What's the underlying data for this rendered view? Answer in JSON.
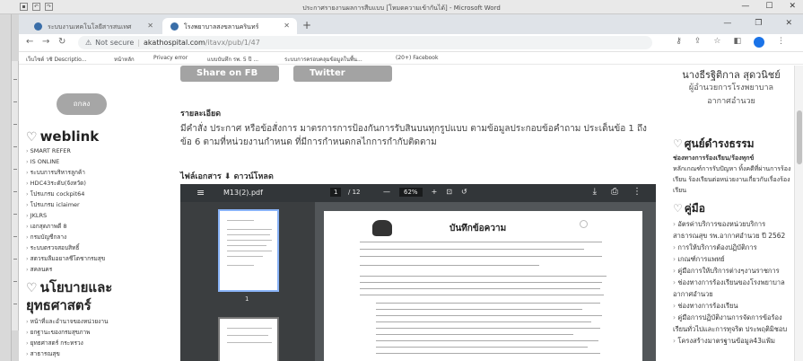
{
  "word": {
    "title": "ประกาศรายงานผลการสืบแบบ [โหมดความเข้ากันได้] - Microsoft Word",
    "controls": [
      "—",
      "☐",
      "✕"
    ]
  },
  "browser": {
    "tabs": [
      {
        "label": "ระบบงานเทคโนโลยีสารสนเทศ",
        "active": false
      },
      {
        "label": "โรงพยาบาลสงขลานครินทร์",
        "active": true
      }
    ],
    "url": {
      "warning": "Not secure",
      "domain": "akathospital.com",
      "path": "/itavx/pub/1/47"
    },
    "bookmarks": [
      "เว็บไซต์ วชิ Descriptio...",
      "หน้าหลัก",
      "Privacy error",
      "แบบบันทึก รพ. 5 ปี ...",
      "ระบบการครอบคลุมข้อมูลในพื้น...",
      "(20+) Facebook"
    ]
  },
  "left_sidebar": {
    "button_label": "ถกลง",
    "weblink_title": "weblink",
    "weblink_items": [
      "SMART REFER",
      "IS ONLINE",
      "ระบบการบริหารลูกค้า",
      "HDC43ระดับ(จังหวัด)",
      "โปรแกรม cockpit64",
      "โปรแกรม iclaimer",
      "JKLRS",
      "เอกสุดภาพดี 8",
      "กรมบัญชีกลาง",
      "ระบบตรวจสอบสิทธิ์",
      "สตวรมลืมอยาลชีโตชากรมสุข",
      "สคลนคร"
    ],
    "policy_title_1": "นโยบายและ",
    "policy_title_2": "ยุทธศาสตร์",
    "policy_items": [
      "หน้าที่และอำนาจของหน่วยงาน",
      "ยกฐานะของกรมสุขภาพ",
      "ยุทธศาสตร์ กระทรวง",
      "สาธารณสุข",
      "ยุทธศาสตร์ของประเทศ",
      "ยุทธศาสตร์ชาติ5200"
    ]
  },
  "article": {
    "share_fb": "Share on FB",
    "share_tw": "Twitter",
    "details_label": "รายละเอียด",
    "details_text": "มีคำสั่ง ประกาศ หรือข้อสั่งการ มาตรการการป้องกันการรับสินบนทุกรูปแบบ ตามข้อมูลประกอบข้อคำถาม ประเด็นข้อ 1 ถึงข้อ 6 ตามที่หน่วยงานกำหนด ที่มีการกำหนดกลไกการกำกับติดตาม",
    "attach_label": "ไฟล์เอกสาร",
    "download_label": "ดาวน์โหลด"
  },
  "pdf": {
    "filename": "M13(2).pdf",
    "page_current": "1",
    "page_total": "/ 12",
    "zoom": "62%",
    "thumb_page": "1",
    "memo_title": "บันทึกข้อความ"
  },
  "right_sidebar": {
    "person_name": "นางธีรฐิติกาล สุดวนิชย์",
    "person_role": "ผู้อำนวยการโรงพยาบาลอากาศอำนวย",
    "center_title": "ศูนย์ดำรงธรรม",
    "center_text_bold": "ช่องทางการร้องเรียน/ร้องทุกข์",
    "center_text": "หลักเกณฑ์การรับปัญหา ทิ้งคดีที่ผ่านการร้องเรียน ร้องเรียนต่อหน่วยงานเกี่ยวกับเรื่องร้องเรียน",
    "manual_title": "คู่มือ",
    "manual_items": [
      "อัตรค่าบริการของหน่วยบริการสาธารณสุข รพ.อากาศอำนวย ปี 2562",
      "การให้บริการต้องปฏิบัติการ",
      "เกณฑ์การแพทย์",
      "คู่มือการให้บริการต่างๆงานราชการ",
      "ช่องทางการร้องเรียนของโรงพยาบาลอากาศอำนวย",
      "ช่องทางการร้องเรียน",
      "คู่มือการปฏิบัติงานการจัดการข้อร้องเรียนทั่วไปและการทุจริต ประพฤติมิชอบ",
      "โครงสร้างมาตรฐานข้อมูล43แฟ้ม"
    ]
  }
}
